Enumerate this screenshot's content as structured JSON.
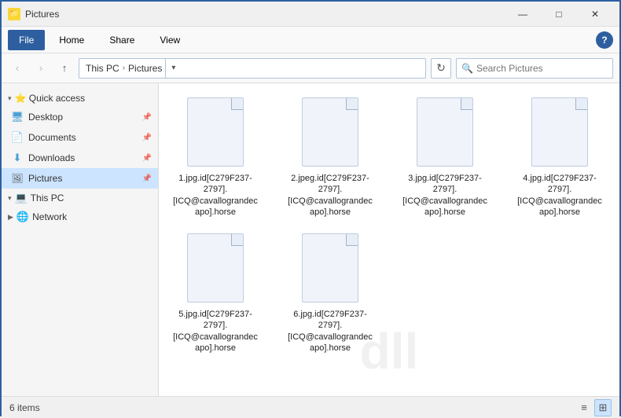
{
  "titleBar": {
    "title": "Pictures",
    "minimize": "—",
    "maximize": "□",
    "close": "✕"
  },
  "ribbon": {
    "tabs": [
      "File",
      "Home",
      "Share",
      "View"
    ],
    "activeTab": "File",
    "help": "?"
  },
  "addressBar": {
    "back": "‹",
    "forward": "›",
    "up": "↑",
    "pathParts": [
      "This PC",
      "Pictures"
    ],
    "refresh": "↻",
    "searchPlaceholder": "Search Pictures"
  },
  "sidebar": {
    "quickAccessLabel": "Quick access",
    "items": [
      {
        "label": "Desktop",
        "type": "desktop",
        "pinned": true
      },
      {
        "label": "Documents",
        "type": "docs",
        "pinned": true
      },
      {
        "label": "Downloads",
        "type": "downloads",
        "pinned": true
      },
      {
        "label": "Pictures",
        "type": "pictures",
        "active": true,
        "pinned": true
      }
    ],
    "thisPCLabel": "This PC",
    "networkLabel": "Network"
  },
  "files": [
    {
      "name": "1.jpg.id[C279F237-2797].[ICQ@cavallograndecapo].horse"
    },
    {
      "name": "2.jpeg.id[C279F237-2797].[ICQ@cavallograndecapo].horse"
    },
    {
      "name": "3.jpg.id[C279F237-2797].[ICQ@cavallograndecapo].horse"
    },
    {
      "name": "4.jpg.id[C279F237-2797].[ICQ@cavallograndecapo].horse"
    },
    {
      "name": "5.jpg.id[C279F237-2797].[ICQ@cavallograndecapo].horse"
    },
    {
      "name": "6.jpg.id[C279F237-2797].[ICQ@cavallograndecapo].horse"
    }
  ],
  "statusBar": {
    "count": "6 items"
  }
}
